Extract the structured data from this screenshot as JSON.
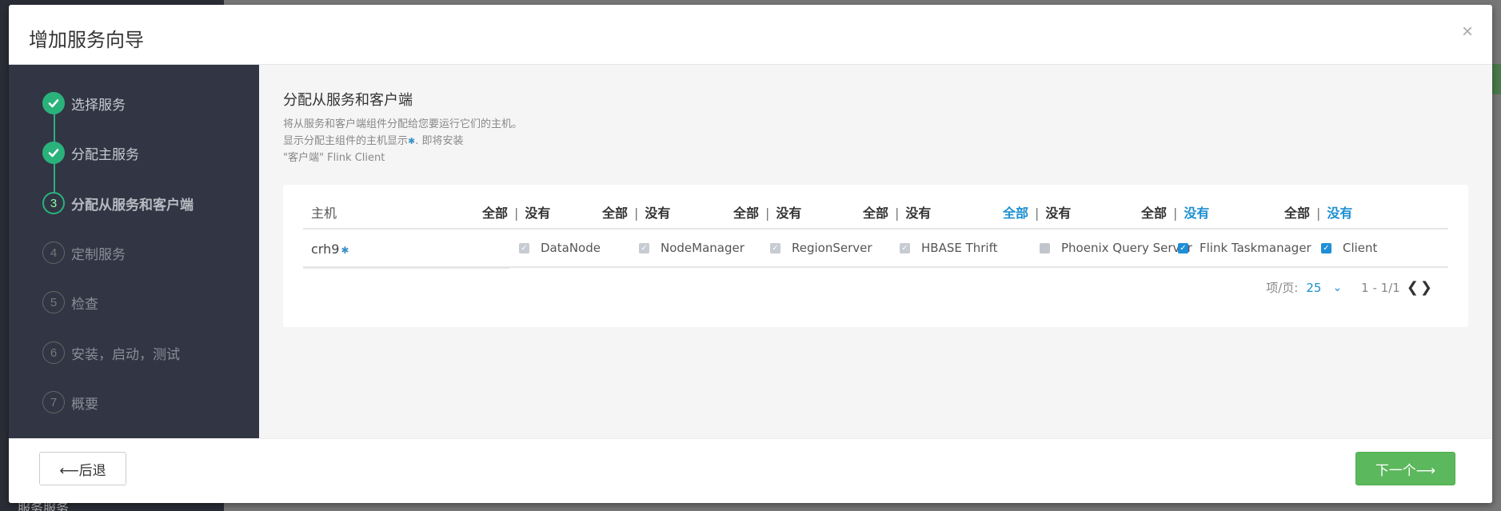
{
  "background": {
    "bottom_text": "服务服务"
  },
  "modal": {
    "title": "增加服务向导",
    "close_glyph": "×"
  },
  "steps": [
    {
      "num": "1",
      "label": "选择服务",
      "state": "done"
    },
    {
      "num": "2",
      "label": "分配主服务",
      "state": "done"
    },
    {
      "num": "3",
      "label": "分配从服务和客户端",
      "state": "current"
    },
    {
      "num": "4",
      "label": "定制服务",
      "state": "pending"
    },
    {
      "num": "5",
      "label": "检查",
      "state": "pending"
    },
    {
      "num": "6",
      "label": "安装，启动，测试",
      "state": "pending"
    },
    {
      "num": "7",
      "label": "概要",
      "state": "pending"
    }
  ],
  "content": {
    "title": "分配从服务和客户端",
    "desc_line1": "将从服务和客户端组件分配给您要运行它们的主机。",
    "desc_line2_pre": "显示分配主组件的主机显示",
    "desc_star": "✱",
    "desc_line2_post": ". 即将安装",
    "desc_line3": "\"客户端\" Flink Client"
  },
  "table": {
    "host_header": "主机",
    "all_label": "全部",
    "none_label": "没有",
    "sep": "|",
    "columns": [
      {
        "component": "DataNode",
        "state": "checked-grey",
        "all_blue": false,
        "none_blue": false
      },
      {
        "component": "NodeManager",
        "state": "checked-grey",
        "all_blue": false,
        "none_blue": false
      },
      {
        "component": "RegionServer",
        "state": "checked-grey",
        "all_blue": false,
        "none_blue": false
      },
      {
        "component": "HBASE Thrift",
        "state": "checked-grey",
        "all_blue": false,
        "none_blue": false
      },
      {
        "component": "Phoenix Query Server",
        "state": "unchecked",
        "all_blue": true,
        "none_blue": false
      },
      {
        "component": "Flink Taskmanager",
        "state": "checked-blue",
        "all_blue": false,
        "none_blue": true
      },
      {
        "component": "Client",
        "state": "checked-blue",
        "all_blue": false,
        "none_blue": true
      }
    ],
    "rows": [
      {
        "host": "crh9",
        "host_star": "✱"
      }
    ]
  },
  "pager": {
    "per_page_label": "项/页:",
    "page_size": "25",
    "chevron": "⌄",
    "range": "1 - 1/1",
    "prev": "❮",
    "next": "❯"
  },
  "footer": {
    "back_label": "⟵后退",
    "next_label": "下一个⟶"
  }
}
